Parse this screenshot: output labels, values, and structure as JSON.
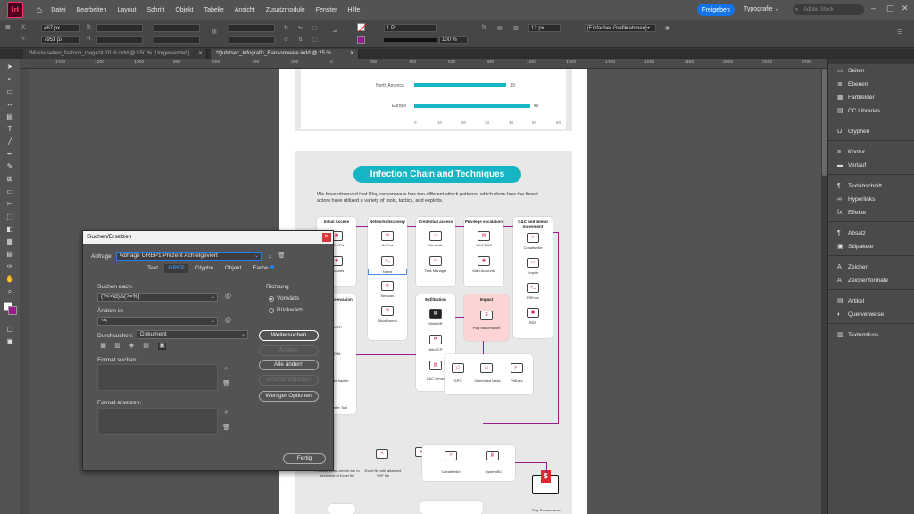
{
  "app": {
    "logo": "Id",
    "menus": [
      "Datei",
      "Bearbeiten",
      "Layout",
      "Schrift",
      "Objekt",
      "Tabelle",
      "Ansicht",
      "Zusatzmodule",
      "Fenster",
      "Hilfe"
    ],
    "share": "Freigeben",
    "workspace": "Typografie",
    "stock_placeholder": "Adobe Stock"
  },
  "control": {
    "x": "467 px",
    "y": "7953 px",
    "stroke": "1 Pt",
    "zoom": "100 %",
    "size": "12 px",
    "opacity": "100 %",
    "frame_style": "[Einfacher Grafikrahmen]+"
  },
  "tabs": [
    {
      "label": "*Musterseiten_fashion_magazin2016.indd @ 150 % [Umgewandelt]"
    },
    {
      "label": "*Qubitsec_Infografic_Ransomware.indd @ 25 %"
    }
  ],
  "ruler": [
    "1400",
    "1200",
    "1000",
    "800",
    "600",
    "400",
    "200",
    "0",
    "200",
    "400",
    "600",
    "800",
    "1000",
    "1200",
    "1400",
    "1600",
    "1800",
    "2000",
    "2200",
    "2400"
  ],
  "panels": [
    {
      "label": "Seiten",
      "icon": "▭"
    },
    {
      "label": "Ebenen",
      "icon": "≣"
    },
    {
      "label": "Farbfelder",
      "icon": "▦"
    },
    {
      "label": "CC Libraries",
      "icon": "▤"
    },
    {
      "label": "Glyphen",
      "icon": "Ω"
    },
    {
      "label": "Kontur",
      "icon": "≡"
    },
    {
      "label": "Verlauf",
      "icon": "▬"
    },
    {
      "label": "Textabschnitt",
      "icon": "¶"
    },
    {
      "label": "Hyperlinks",
      "icon": "∞"
    },
    {
      "label": "Effekte",
      "icon": "fx"
    },
    {
      "label": "Absatz",
      "icon": "¶"
    },
    {
      "label": "Stilpakete",
      "icon": "▣"
    },
    {
      "label": "Zeichen",
      "icon": "A"
    },
    {
      "label": "Zeichenformate",
      "icon": "A"
    },
    {
      "label": "Artikel",
      "icon": "▤"
    },
    {
      "label": "Querverweise",
      "icon": "◐"
    },
    {
      "label": "Textumfluss",
      "icon": "▥"
    }
  ],
  "infographic": {
    "bars": [
      {
        "label": "North America",
        "value": 39
      },
      {
        "label": "Europe",
        "value": 49
      }
    ],
    "ticks": [
      "0",
      "10",
      "20",
      "30",
      "40",
      "50",
      "60"
    ],
    "title": "Infection Chain and Techniques",
    "intro": "We have observed that Play ransomware has two different attack patterns, which show how the threat actors have utilized a variety of tools, tactics, and exploits.",
    "cols": [
      "Initial Access",
      "Network discovery",
      "Credential access",
      "Privilege escalation",
      "C&C and lateral movement"
    ],
    "col1": [
      "SSL VPN",
      "Accounts"
    ],
    "col2": [
      "AdFind",
      "Nltest",
      "Netscan",
      "Bloodhound"
    ],
    "col3": [
      "Mimikatz",
      "Task Manager"
    ],
    "col4": [
      "WinPEAS",
      "Valid Accounts"
    ],
    "col5": [
      "Cobaltstrike",
      "Empire",
      "PSExec",
      "RDP"
    ],
    "evasion": "Defense evasion",
    "evasion_items": [
      "GMER",
      "IOBit",
      "Process hacker",
      "Pchunter Tool"
    ],
    "exfil_title": "Exfiltration",
    "exfil": [
      "WinRAR",
      "WinSCP",
      "C&C server"
    ],
    "impact_title": "Impact",
    "impact": "Play ransomware",
    "gpo": [
      "GPO",
      "Scheduled tasks",
      "PsExec"
    ],
    "bottom": [
      "Phished email arrival due to presence of Excel file",
      "Excel file with attached VHF file",
      "Cobaltstrike",
      "SystemBC",
      "Play Ransomware"
    ]
  },
  "dialog": {
    "title": "Suchen/Ersetzen",
    "query_label": "Abfrage:",
    "query_value": "Abfrage GREP1 Prozent Achtelgeviert",
    "tabs": [
      "Text",
      "GREP",
      "Glyphe",
      "Objekt",
      "Farbe"
    ],
    "search_label": "Suchen nach:",
    "search_value": "(?<=\\d)\\s(?=%)",
    "replace_label": "Ändern in:",
    "replace_value": "~<",
    "scope_label": "Durchsuchen:",
    "scope_value": "Dokument",
    "direction_label": "Richtung",
    "forward": "Vorwärts",
    "backward": "Rückwärts",
    "format_search": "Format suchen:",
    "format_replace": "Format ersetzen:",
    "buttons": {
      "find_next": "Weitersuchen",
      "change": "Ändern",
      "change_all": "Alle ändern",
      "change_find": "Ersetzen/Suchen",
      "fewer": "Weniger Optionen",
      "done": "Fertig"
    }
  }
}
